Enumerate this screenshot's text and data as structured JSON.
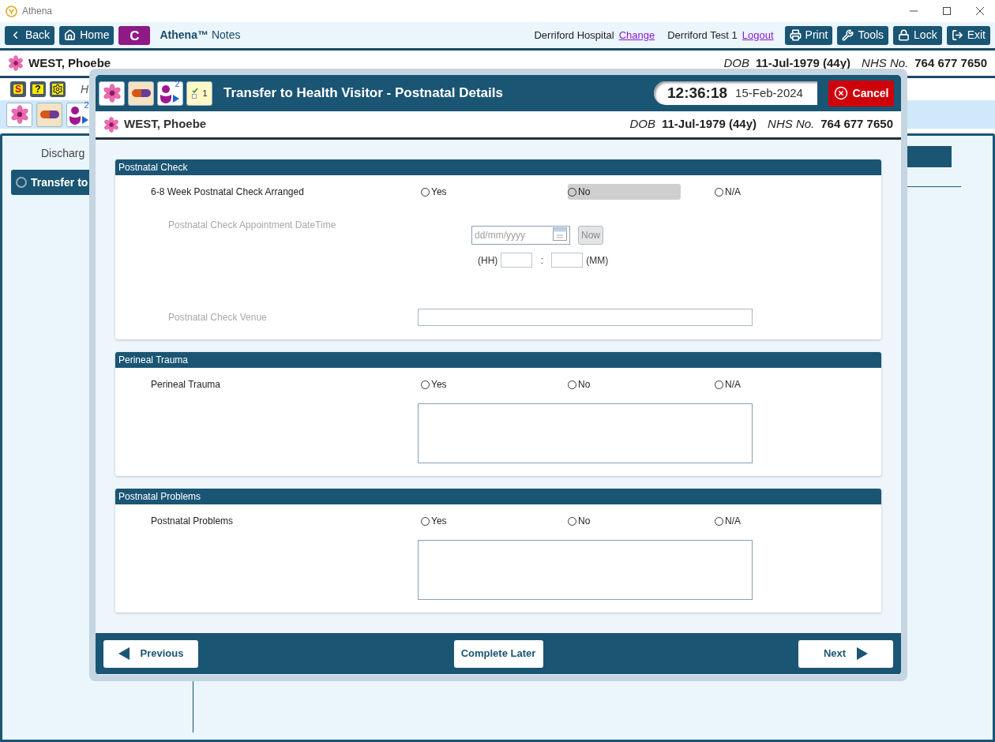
{
  "window": {
    "title": "Athena"
  },
  "toolbar": {
    "left_buttons": [
      {
        "label": "Back",
        "kind": "back"
      },
      {
        "label": "Home",
        "kind": "home"
      }
    ],
    "c_button": "C",
    "app_name": "Athena™",
    "app_sub": "Notes",
    "hospital": "Derriford Hospital",
    "change_link": "Change",
    "user": "Derriford Test 1",
    "logout_link": "Logout",
    "right_buttons": [
      {
        "label": "Print",
        "kind": "print"
      },
      {
        "label": "Tools",
        "kind": "tools"
      },
      {
        "label": "Lock",
        "kind": "lock"
      },
      {
        "label": "Exit",
        "kind": "exit"
      }
    ]
  },
  "patient": {
    "name": "WEST, Phoebe",
    "dob_label": "DOB",
    "dob": "11-Jul-1979 (44y)",
    "nhs_label": "NHS No.",
    "nhs": "764 677 7650"
  },
  "alert_icons": [
    {
      "kind": "sign",
      "label": "S"
    },
    {
      "kind": "help",
      "label": "?"
    },
    {
      "kind": "settings"
    }
  ],
  "partial_text": "H",
  "background_icons": [
    {
      "kind": "flower"
    },
    {
      "kind": "pill"
    },
    {
      "kind": "person",
      "badge": "2"
    }
  ],
  "sidebar": {
    "heading": "Discharg",
    "items": [
      {
        "label": "Transfer to",
        "selected": true
      }
    ]
  },
  "modal": {
    "icons": [
      {
        "kind": "flower"
      },
      {
        "kind": "pill"
      },
      {
        "kind": "person",
        "badge": "2"
      },
      {
        "kind": "notes",
        "badge": "1"
      }
    ],
    "title": "Transfer to Health Visitor - Postnatal Details",
    "time": "12:36:18",
    "date": "15-Feb-2024",
    "cancel": "Cancel",
    "patient": {
      "name": "WEST, Phoebe",
      "dob_label": "DOB",
      "dob": "11-Jul-1979 (44y)",
      "nhs_label": "NHS No.",
      "nhs": "764 677 7650"
    },
    "sections": [
      {
        "title": "Postnatal Check",
        "fields": [
          {
            "kind": "radio",
            "label": "6-8 Week Postnatal Check Arranged",
            "options": [
              {
                "label": "Yes",
                "selected": false,
                "highlighted": false
              },
              {
                "label": "No",
                "selected": false,
                "highlighted": true
              },
              {
                "label": "N/A",
                "selected": false,
                "highlighted": false
              }
            ]
          },
          {
            "kind": "datetime",
            "label": "Postnatal Check Appointment DateTime",
            "disabled": true,
            "placeholder": "dd/mm/yyyy",
            "now": "Now",
            "hh": "(HH)",
            "separator": ":",
            "mm": "(MM)"
          },
          {
            "kind": "text",
            "label": "Postnatal Check Venue",
            "disabled": true
          }
        ]
      },
      {
        "title": "Perineal Trauma",
        "fields": [
          {
            "kind": "radio",
            "label": "Perineal Trauma",
            "options": [
              {
                "label": "Yes",
                "selected": false,
                "highlighted": false
              },
              {
                "label": "No",
                "selected": false,
                "highlighted": false
              },
              {
                "label": "N/A",
                "selected": false,
                "highlighted": false
              }
            ]
          },
          {
            "kind": "textarea"
          }
        ]
      },
      {
        "title": "Postnatal Problems",
        "fields": [
          {
            "kind": "radio",
            "label": "Postnatal Problems",
            "options": [
              {
                "label": "Yes",
                "selected": false,
                "highlighted": false
              },
              {
                "label": "No",
                "selected": false,
                "highlighted": false
              },
              {
                "label": "N/A",
                "selected": false,
                "highlighted": false
              }
            ]
          },
          {
            "kind": "textarea"
          }
        ]
      }
    ],
    "footer": {
      "previous": "Previous",
      "complete_later": "Complete Later",
      "next": "Next"
    }
  }
}
